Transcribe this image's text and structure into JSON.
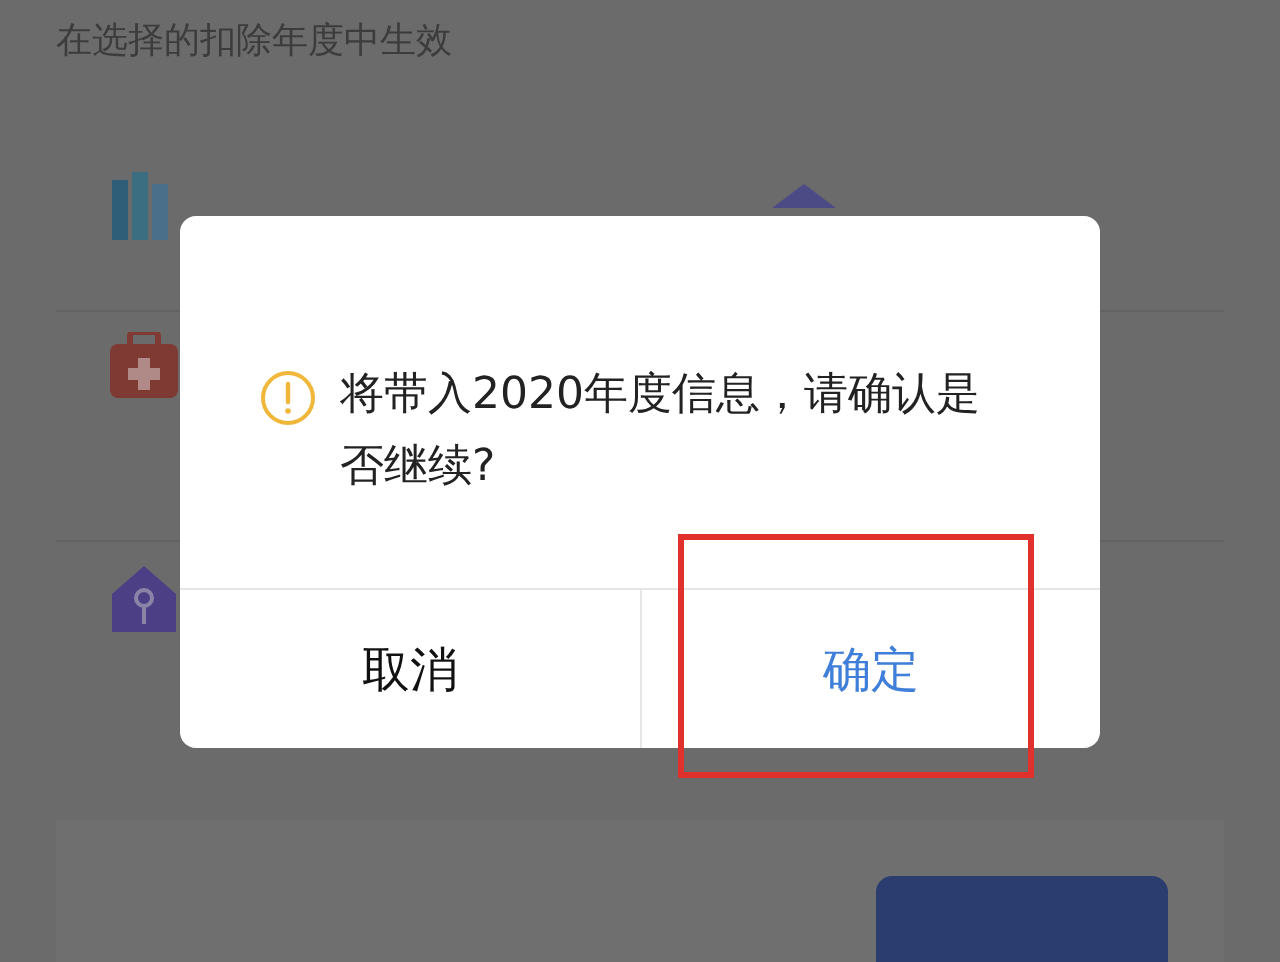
{
  "page": {
    "subtitle": "在选择的扣除年度中生效"
  },
  "dialog": {
    "message": "将带入2020年度信息，请确认是否继续?",
    "buttons": [
      {
        "label": "取消",
        "kind": "cancel"
      },
      {
        "label": "确定",
        "kind": "confirm"
      }
    ]
  }
}
